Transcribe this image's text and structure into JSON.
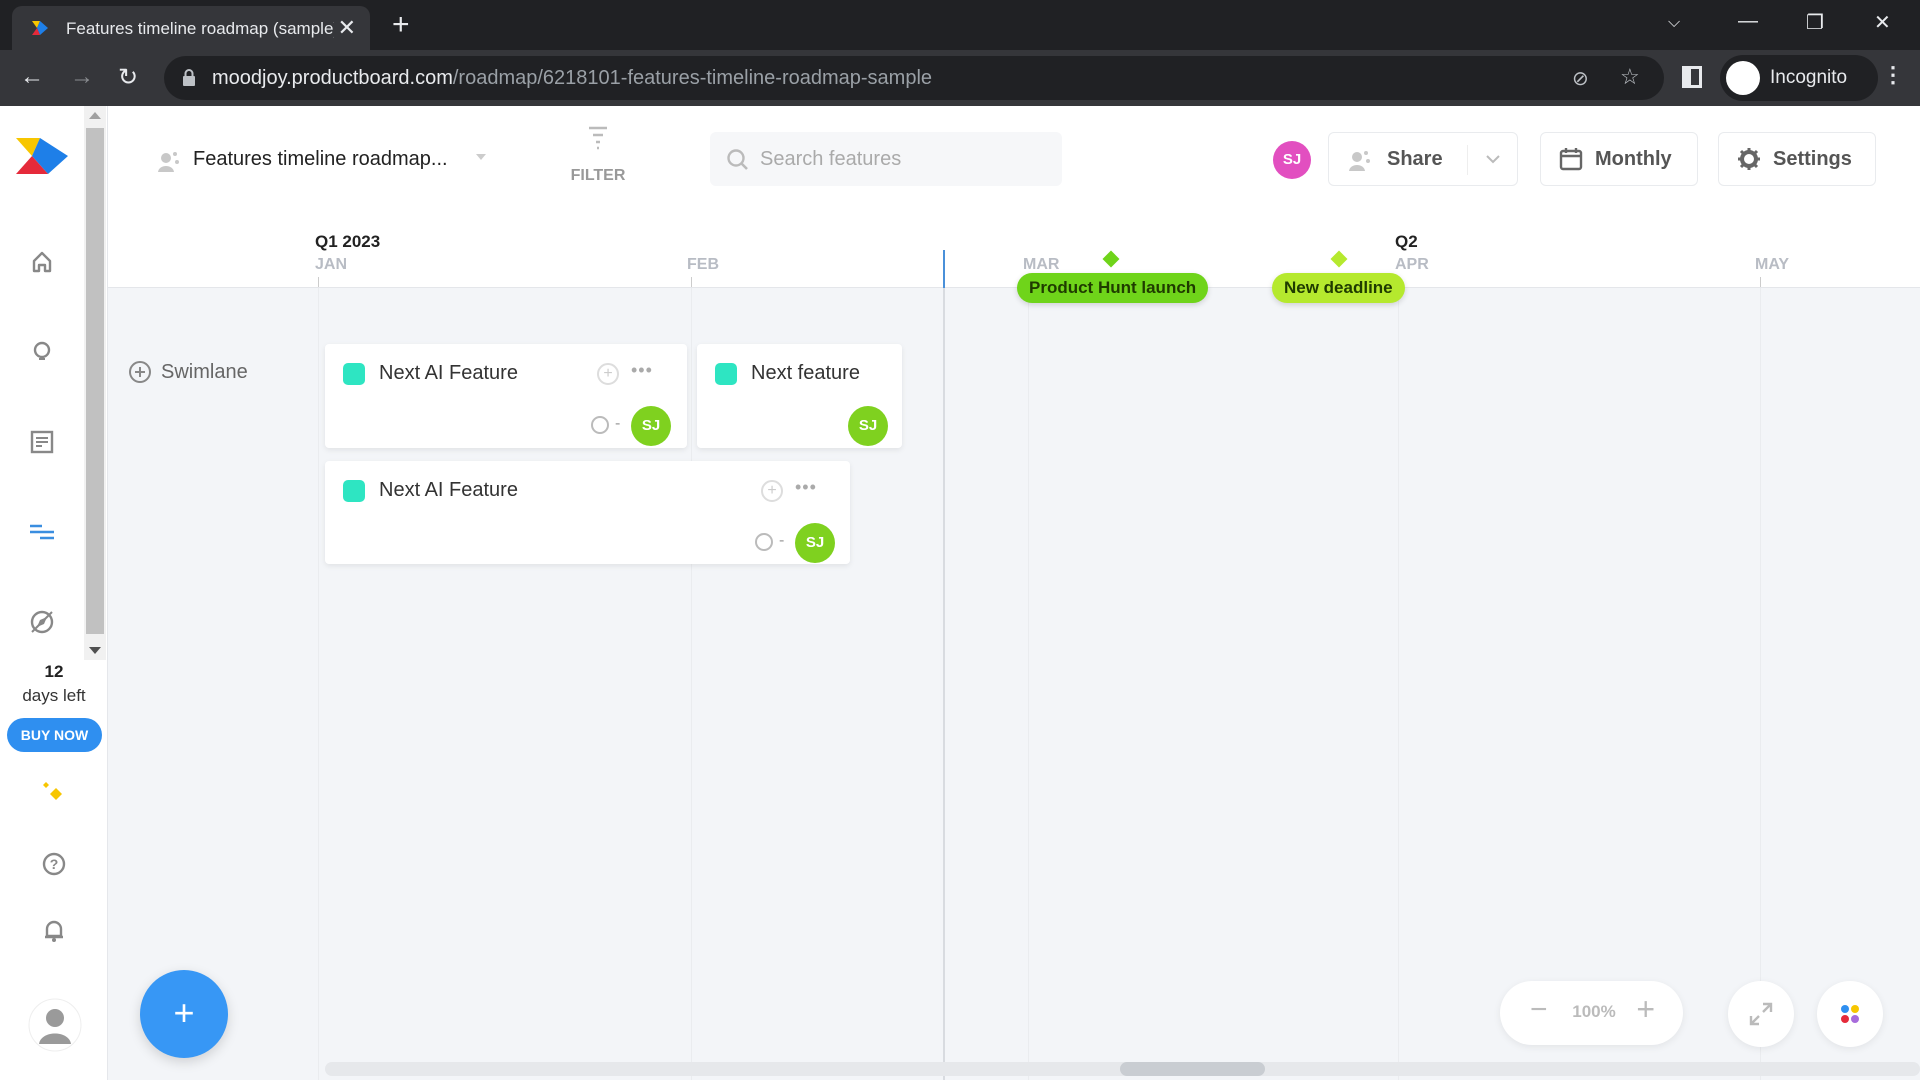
{
  "browser": {
    "tab_title": "Features timeline roadmap (sample)",
    "url_host": "moodjoy.productboard.com",
    "url_path": "/roadmap/6218101-features-timeline-roadmap-sample",
    "profile_label": "Incognito"
  },
  "sidebar": {
    "items": [
      {
        "name": "home",
        "icon": "home-icon"
      },
      {
        "name": "insights",
        "icon": "lightbulb-icon"
      },
      {
        "name": "features",
        "icon": "document-icon"
      },
      {
        "name": "roadmaps",
        "icon": "roadmap-icon",
        "active": true
      },
      {
        "name": "portal",
        "icon": "compass-icon"
      }
    ],
    "trial_days": "12",
    "trial_label": "days left",
    "buy_now": "BUY NOW",
    "bottom_items": [
      "sparkle-icon",
      "help-icon",
      "bell-icon",
      "user-avatar"
    ]
  },
  "toolbar": {
    "roadmap_title": "Features timeline roadmap...",
    "filter_label": "FILTER",
    "search_placeholder": "Search features",
    "search_value": "",
    "user_initials": "SJ",
    "share_label": "Share",
    "view_label": "Monthly",
    "settings_label": "Settings"
  },
  "timeline": {
    "quarters": [
      {
        "label": "Q1 2023"
      },
      {
        "label": "Q2"
      }
    ],
    "months": [
      "JAN",
      "FEB",
      "MAR",
      "APR",
      "MAY"
    ],
    "milestones": [
      {
        "label": "Product Hunt launch",
        "color": "#6fd41a"
      },
      {
        "label": "New deadline",
        "color": "#b5e92e"
      }
    ]
  },
  "swimlane": {
    "add_label": "Swimlane",
    "cards": [
      {
        "title": "Next AI Feature",
        "owner": "SJ",
        "date": "-",
        "color": "#2ee5c2"
      },
      {
        "title": "Next feature",
        "owner": "SJ",
        "color": "#2ee5c2"
      },
      {
        "title": "Next AI Feature",
        "owner": "SJ",
        "date": "-",
        "color": "#2ee5c2"
      }
    ]
  },
  "controls": {
    "fab_label": "+",
    "zoom_level": "100%",
    "zoom_out": "−",
    "zoom_in": "+"
  }
}
